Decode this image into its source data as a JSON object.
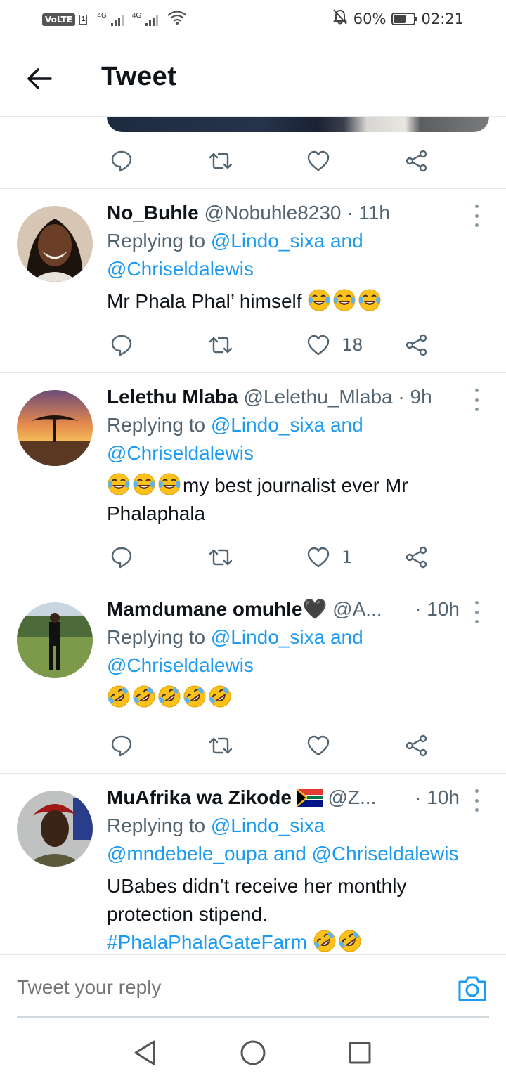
{
  "status_bar": {
    "volte": "VoLTE",
    "sim": "1",
    "net1": "4G",
    "net2": "4G",
    "battery_percent": "60%",
    "battery_level": 0.6,
    "time": "02:21"
  },
  "header": {
    "back_icon": "arrow-left-icon",
    "title": "Tweet"
  },
  "top_tweet_actions": {
    "reply_count": "",
    "retweet_count": "",
    "like_count": "",
    "share_icon": "share-icon"
  },
  "replies": [
    {
      "name": "No_Buhle",
      "handle": "@Nobuhle8230",
      "time": "· 11h",
      "replying_prefix": "Replying to ",
      "replying_line1": "@Lindo_sixa and",
      "replying_line2": "@Chriseldalewis",
      "text": "Mr Phala Phal’ himself",
      "emoji": [
        "face-with-tears-of-joy",
        "face-with-tears-of-joy",
        "face-with-tears-of-joy"
      ],
      "like_count": "18"
    },
    {
      "name": "Lelethu Mlaba",
      "handle": "@Lelethu_Mlaba",
      "time": "· 9h",
      "replying_prefix": "Replying to ",
      "replying_line1": "@Lindo_sixa and",
      "replying_line2": "@Chriseldalewis",
      "emoji": [
        "face-with-tears-of-joy",
        "face-with-tears-of-joy",
        "face-with-tears-of-joy"
      ],
      "text_line1": "my best journalist ever  Mr",
      "text_line2": "Phalaphala",
      "like_count": "1"
    },
    {
      "name": "Mamdumane omuhle🖤",
      "handle": "@A...",
      "time": "· 10h",
      "replying_prefix": "Replying to ",
      "replying_line1": "@Lindo_sixa and",
      "replying_line2": "@Chriseldalewis",
      "emoji": [
        "rolling-on-the-floor-laughing",
        "rolling-on-the-floor-laughing",
        "rolling-on-the-floor-laughing",
        "rolling-on-the-floor-laughing",
        "rolling-on-the-floor-laughing"
      ],
      "like_count": ""
    },
    {
      "name": "MuAfrika wa Zikode",
      "flag": "south-africa-flag",
      "handle": "@Z...",
      "time": "· 10h",
      "replying_prefix": "Replying to ",
      "replying_line1": "@Lindo_sixa",
      "replying_line2": "@mndebele_oupa and @Chriseldalewis",
      "text_line1": "UBabes didn’t receive her monthly",
      "text_line2": "protection stipend.",
      "hashtag": "#PhalaPhalaGateFarm",
      "emoji": [
        "rolling-on-the-floor-laughing",
        "rolling-on-the-floor-laughing"
      ]
    }
  ],
  "reply_bar": {
    "placeholder": "Tweet your reply",
    "camera_icon": "camera-icon"
  },
  "nav_bar": {
    "back": "triangle-back-icon",
    "home": "circle-home-icon",
    "recents": "square-recents-icon"
  },
  "colors": {
    "accent": "#1d9bf0",
    "text": "#0f1419",
    "secondary": "#536471",
    "divider": "#e6e9eb"
  }
}
